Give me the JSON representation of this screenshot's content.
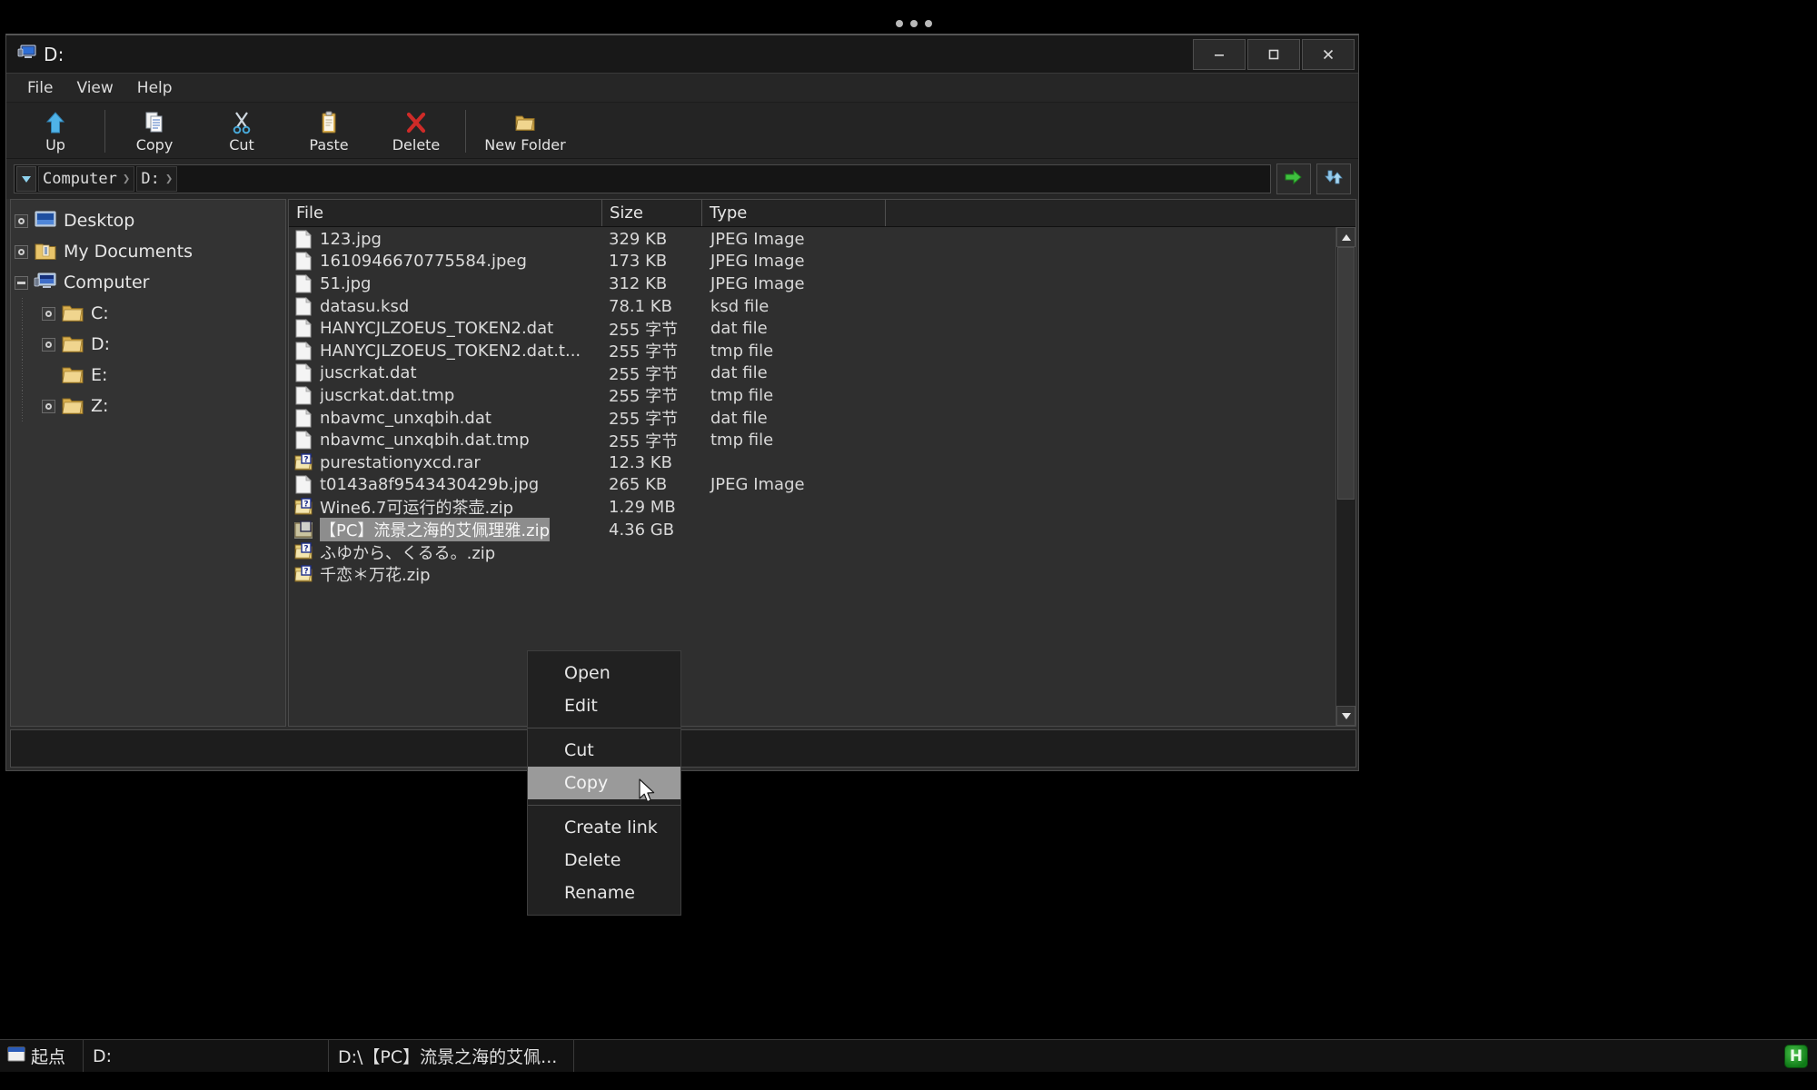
{
  "window": {
    "title": "D:",
    "title_icon": "computer-drive-icon",
    "buttons": {
      "minimize": "—",
      "maximize": "☐",
      "close": "✕"
    }
  },
  "menubar": {
    "items": [
      "File",
      "View",
      "Help"
    ]
  },
  "toolbar": {
    "buttons": [
      {
        "label": "Up",
        "icon": "up-arrow-icon"
      },
      {
        "label": "Copy",
        "icon": "copy-pages-icon"
      },
      {
        "label": "Cut",
        "icon": "scissors-icon"
      },
      {
        "label": "Paste",
        "icon": "clipboard-icon"
      },
      {
        "label": "Delete",
        "icon": "red-x-icon"
      },
      {
        "label": "New Folder",
        "icon": "folder-icon"
      }
    ]
  },
  "addressbar": {
    "dropdown_icon": "chevron-down-icon",
    "crumbs": [
      "Computer",
      "D:"
    ],
    "go_icon": "green-go-arrow-icon",
    "refresh_icon": "refresh-icon"
  },
  "tree": {
    "items": [
      {
        "label": "Desktop",
        "icon": "desktop-icon",
        "expander": "plus",
        "indent": 0
      },
      {
        "label": "My Documents",
        "icon": "documents-folder-icon",
        "expander": "plus",
        "indent": 0
      },
      {
        "label": "Computer",
        "icon": "computer-icon",
        "expander": "minus",
        "indent": 0
      },
      {
        "label": "C:",
        "icon": "folder-icon",
        "expander": "plus",
        "indent": 1
      },
      {
        "label": "D:",
        "icon": "folder-icon",
        "expander": "plus",
        "indent": 1
      },
      {
        "label": "E:",
        "icon": "folder-icon",
        "expander": "none",
        "indent": 1
      },
      {
        "label": "Z:",
        "icon": "folder-icon",
        "expander": "plus",
        "indent": 1
      }
    ]
  },
  "filelist": {
    "columns": [
      "File",
      "Size",
      "Type"
    ],
    "rows": [
      {
        "name": "123.jpg",
        "size": "329 KB",
        "type": "JPEG Image",
        "icon": "file-icon",
        "selected": false
      },
      {
        "name": "1610946670775584.jpeg",
        "size": "173 KB",
        "type": "JPEG Image",
        "icon": "file-icon",
        "selected": false
      },
      {
        "name": "51.jpg",
        "size": "312 KB",
        "type": "JPEG Image",
        "icon": "file-icon",
        "selected": false
      },
      {
        "name": "datasu.ksd",
        "size": "78.1 KB",
        "type": "ksd file",
        "icon": "file-icon",
        "selected": false
      },
      {
        "name": "HANYCJLZOEUS_TOKEN2.dat",
        "size": "255 字节",
        "type": "dat file",
        "icon": "file-icon",
        "selected": false
      },
      {
        "name": "HANYCJLZOEUS_TOKEN2.dat.t...",
        "size": "255 字节",
        "type": "tmp file",
        "icon": "file-icon",
        "selected": false
      },
      {
        "name": "juscrkat.dat",
        "size": "255 字节",
        "type": "dat file",
        "icon": "file-icon",
        "selected": false
      },
      {
        "name": "juscrkat.dat.tmp",
        "size": "255 字节",
        "type": "tmp file",
        "icon": "file-icon",
        "selected": false
      },
      {
        "name": "nbavmc_unxqbih.dat",
        "size": "255 字节",
        "type": "dat file",
        "icon": "file-icon",
        "selected": false
      },
      {
        "name": "nbavmc_unxqbih.dat.tmp",
        "size": "255 字节",
        "type": "tmp file",
        "icon": "file-icon",
        "selected": false
      },
      {
        "name": "purestationyxcd.rar",
        "size": "12.3 KB",
        "type": "",
        "icon": "archive-icon",
        "selected": false
      },
      {
        "name": "t0143a8f9543430429b.jpg",
        "size": "265 KB",
        "type": "JPEG Image",
        "icon": "file-icon",
        "selected": false
      },
      {
        "name": "Wine6.7可运行的茶壶.zip",
        "size": "1.29 MB",
        "type": "",
        "icon": "archive-icon",
        "selected": false
      },
      {
        "name": "【PC】流景之海的艾佩理雅.zip",
        "size": "4.36 GB",
        "type": "",
        "icon": "archive-selected-icon",
        "selected": true
      },
      {
        "name": "ふゆから、くるる。.zip",
        "size": "",
        "type": "",
        "icon": "archive-icon",
        "selected": false
      },
      {
        "name": "千恋＊万花.zip",
        "size": "",
        "type": "",
        "icon": "archive-icon",
        "selected": false
      }
    ]
  },
  "contextmenu": {
    "items": [
      {
        "label": "Open",
        "active": false
      },
      {
        "label": "Edit",
        "active": false
      },
      {
        "separator": true
      },
      {
        "label": "Cut",
        "active": false
      },
      {
        "label": "Copy",
        "active": true
      },
      {
        "separator": true
      },
      {
        "label": "Create link",
        "active": false
      },
      {
        "label": "Delete",
        "active": false
      },
      {
        "label": "Rename",
        "active": false
      }
    ]
  },
  "taskbar": {
    "start_label": "起点",
    "start_icon": "start-window-icon",
    "items": [
      "D:",
      "D:\\【PC】流景之海的艾佩..."
    ],
    "tray": {
      "label": "H",
      "icon": "hamachi-tray-icon",
      "color": "#2bae31"
    }
  },
  "colors": {
    "window_bg": "#2d2d2d",
    "titlebar_bg": "#181818",
    "selection": "#8d8d8d",
    "menu_highlight": "#9a9a9a",
    "accent_green": "#2bae31"
  }
}
